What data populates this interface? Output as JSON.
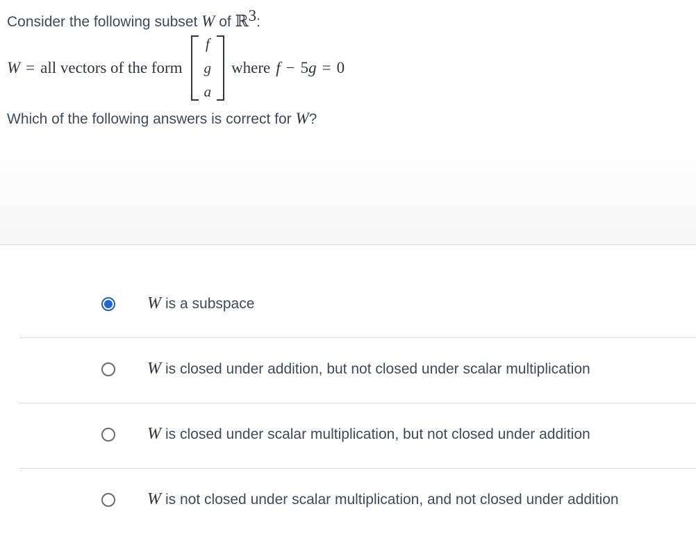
{
  "question": {
    "intro_prefix": "Consider the following subset",
    "intro_var": "W",
    "intro_of": "of",
    "intro_space": "ℝ",
    "intro_exp": "3",
    "intro_suffix": ":",
    "def_var": "W",
    "def_eq": "=",
    "def_text": "all vectors of the form",
    "vector": [
      "f",
      "g",
      "a"
    ],
    "where_text": "where",
    "cond_f": "f",
    "cond_op": "−",
    "cond_coef": "5",
    "cond_g": "g",
    "cond_eq": "=",
    "cond_rhs": "0",
    "prompt_prefix": "Which of the following answers is correct for",
    "prompt_var": "W",
    "prompt_suffix": "?"
  },
  "options": [
    {
      "var": "W",
      "text": "is a subspace",
      "selected": true
    },
    {
      "var": "W",
      "text": "is closed under addition, but not closed under scalar multiplication",
      "selected": false
    },
    {
      "var": "W",
      "text": "is closed under scalar multiplication, but not closed under addition",
      "selected": false
    },
    {
      "var": "W",
      "text": "is not closed under scalar multiplication, and not closed under addition",
      "selected": false
    }
  ],
  "colors": {
    "selected_radio": "#1e66de",
    "text": "#3d4a5c",
    "divider": "#dcdcdc"
  }
}
